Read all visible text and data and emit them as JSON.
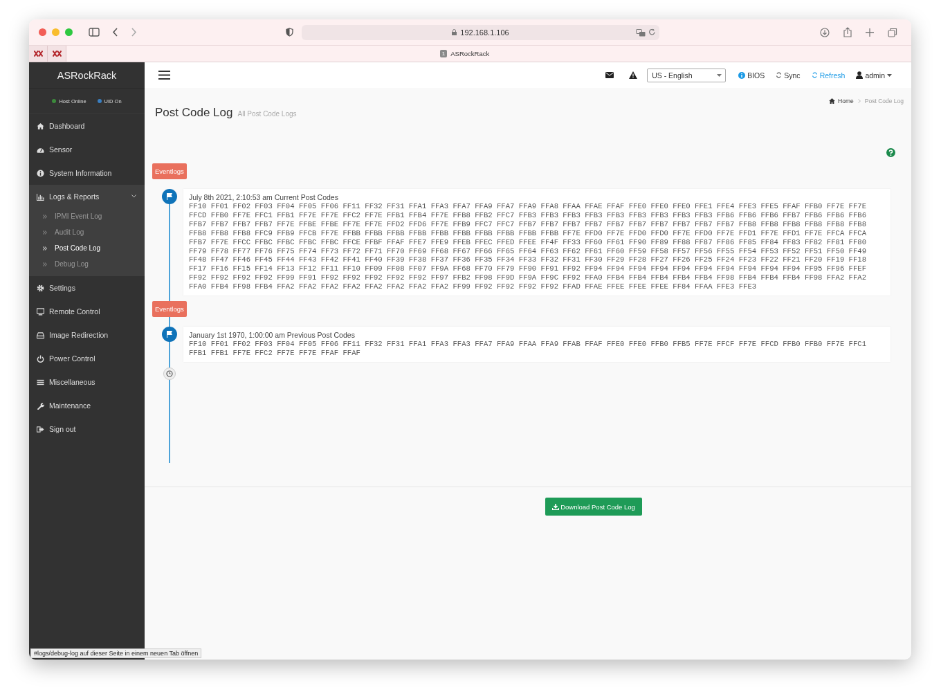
{
  "browser": {
    "url": "192.168.1.106",
    "tab": {
      "badge": "1",
      "title": "ASRockRack"
    },
    "status_link": "#logs/debug-log auf dieser Seite in einem neuen Tab öffnen"
  },
  "sidebar": {
    "brand": "ASRockRack",
    "status": [
      {
        "label": "Host Online",
        "color": "#3c8a3c"
      },
      {
        "label": "UID On",
        "color": "#3a7fc1"
      }
    ],
    "items": [
      {
        "label": "Dashboard",
        "expanded": false
      },
      {
        "label": "Sensor",
        "expanded": false
      },
      {
        "label": "System Information",
        "expanded": false
      },
      {
        "label": "Logs & Reports",
        "expanded": true,
        "children": [
          {
            "label": "IPMI Event Log",
            "selected": false
          },
          {
            "label": "Audit Log",
            "selected": false
          },
          {
            "label": "Post Code Log",
            "selected": true
          },
          {
            "label": "Debug Log",
            "selected": false
          }
        ]
      },
      {
        "label": "Settings",
        "expanded": false
      },
      {
        "label": "Remote Control",
        "expanded": false
      },
      {
        "label": "Image Redirection",
        "expanded": false
      },
      {
        "label": "Power Control",
        "expanded": false
      },
      {
        "label": "Miscellaneous",
        "expanded": false
      },
      {
        "label": "Maintenance",
        "expanded": false
      },
      {
        "label": "Sign out",
        "expanded": false
      }
    ]
  },
  "header": {
    "language": "US - English",
    "links": [
      "BIOS",
      "Sync",
      "Refresh",
      "admin"
    ]
  },
  "breadcrumb": [
    "Home",
    "Post Code Log"
  ],
  "page": {
    "title": "Post Code Log",
    "subtitle": "All Post Code Logs"
  },
  "timeline": [
    {
      "tag": "Eventlogs",
      "heading": "July 8th 2021, 2:10:53 am Current Post Codes",
      "lines": [
        "FF10 FF01 FF02 FF03 FF04 FF05 FF06 FF11 FF32 FF31 FFA1 FFA3 FFA7 FFA9 FFA7 FFA9 FFA8 FFAA FFAE FFAF FFE0 FFE0 FFE0 FFE1 FFE4 FFE3 FFE5 FFAF FFB0 FF7E FF7E",
        "FFCD FFB0 FF7E FFC1 FFB1 FF7E FF7E FFC2 FF7E FFB1 FFB4 FF7E FFB8 FFB2 FFC7 FFB3 FFB3 FFB3 FFB3 FFB3 FFB3 FFB3 FFB3 FFB3 FFB6 FFB6 FFB6 FFB7 FFB6 FFB6 FFB6",
        "FFB7 FFB7 FFB7 FFB7 FF7E FFBE FFBE FF7E FF7E FFD2 FFD6 FF7E FFB9 FFC7 FFC7 FFB7 FFB7 FFB7 FFB7 FFB7 FFB7 FFB7 FFB7 FFB7 FFB7 FFB8 FFB8 FFB8 FFB8 FFB8 FFB8",
        "FFB8 FFB8 FFB8 FFC9 FFB9 FFCB FF7E FFBB FFBB FFBB FFBB FFBB FFBB FFBB FFBB FFBB FFBB FF7E FFD0 FF7E FFD0 FFD0 FF7E FFD0 FF7E FFD1 FF7E FFD1 FF7E FFCA FFCA",
        "FFB7 FF7E FFCC FFBC FFBC FFBC FFBC FFCE FFBF FFAF FFE7 FFE9 FFEB FFEC FFED FFEE FF4F FF33 FF60 FF61 FF90 FF89 FF88 FF87 FF86 FF85 FF84 FF83 FF82 FF81 FF80",
        "FF79 FF78 FF77 FF76 FF75 FF74 FF73 FF72 FF71 FF70 FF69 FF68 FF67 FF66 FF65 FF64 FF63 FF62 FF61 FF60 FF59 FF58 FF57 FF56 FF55 FF54 FF53 FF52 FF51 FF50 FF49",
        "FF48 FF47 FF46 FF45 FF44 FF43 FF42 FF41 FF40 FF39 FF38 FF37 FF36 FF35 FF34 FF33 FF32 FF31 FF30 FF29 FF28 FF27 FF26 FF25 FF24 FF23 FF22 FF21 FF20 FF19 FF18",
        "FF17 FF16 FF15 FF14 FF13 FF12 FF11 FF10 FF09 FF08 FF07 FF9A FF68 FF70 FF79 FF90 FF91 FF92 FF94 FF94 FF94 FF94 FF94 FF94 FF94 FF94 FF94 FF94 FF95 FF96 FFEF",
        "FF92 FF92 FF92 FF92 FF99 FF91 FF92 FF92 FF92 FF92 FF92 FF97 FFB2 FF98 FF9D FF9A FF9C FF92 FFA0 FFB4 FFB4 FFB4 FFB4 FFB4 FF98 FFB4 FFB4 FFB4 FF98 FFA2 FFA2",
        "FFA0 FFB4 FF98 FFB4 FFA2 FFA2 FFA2 FFA2 FFA2 FFA2 FFA2 FFA2 FF99 FF92 FF92 FF92 FF92 FFAD FFAE FFEE FFEE FFEE FF84 FFAA FFE3 FFE3"
      ]
    },
    {
      "tag": "Eventlogs",
      "heading": "January 1st 1970, 1:00:00 am Previous Post Codes",
      "lines": [
        "FF10 FF01 FF02 FF03 FF04 FF05 FF06 FF11 FF32 FF31 FFA1 FFA3 FFA3 FFA7 FFA9 FFAA FFA9 FFAB FFAF FFE0 FFE0 FFB0 FFB5 FF7E FFCF FF7E FFCD FFB0 FFB0 FF7E FFC1",
        "FFB1 FFB1 FF7E FFC2 FF7E FF7E FFAF FFAF"
      ]
    }
  ],
  "download_button": "Download Post Code Log"
}
